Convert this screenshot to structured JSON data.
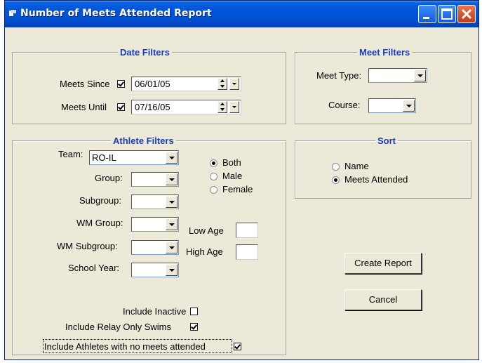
{
  "window": {
    "title": "Number of Meets Attended Report"
  },
  "date_filters": {
    "title": "Date Filters",
    "meets_since_label": "Meets Since",
    "meets_since_checked": true,
    "meets_since_value": "06/01/05",
    "meets_until_label": "Meets Until",
    "meets_until_checked": true,
    "meets_until_value": "07/16/05"
  },
  "meet_filters": {
    "title": "Meet Filters",
    "meet_type_label": "Meet Type:",
    "meet_type_value": "",
    "course_label": "Course:",
    "course_value": ""
  },
  "athlete_filters": {
    "title": "Athlete Filters",
    "team_label": "Team:",
    "team_value": "RO-IL",
    "group_label": "Group:",
    "subgroup_label": "Subgroup:",
    "wm_group_label": "WM Group:",
    "wm_subgroup_label": "WM Subgroup:",
    "school_year_label": "School Year:",
    "gender_options": [
      "Both",
      "Male",
      "Female"
    ],
    "gender_selected": "Both",
    "low_age_label": "Low Age",
    "high_age_label": "High Age",
    "include_inactive_label": "Include Inactive",
    "include_inactive_checked": false,
    "include_relay_only_label": "Include Relay Only Swims",
    "include_relay_only_checked": true,
    "include_no_meets_label": "Include Athletes with no meets attended",
    "include_no_meets_checked": true
  },
  "sort": {
    "title": "Sort",
    "options": [
      "Name",
      "Meets Attended"
    ],
    "selected": "Meets Attended"
  },
  "actions": {
    "create_report_label": "Create Report",
    "cancel_label": "Cancel"
  },
  "colors": {
    "titlebar": "#0053d9",
    "frame_title": "#1a3fb5",
    "window_bg": "#ece9d8"
  }
}
